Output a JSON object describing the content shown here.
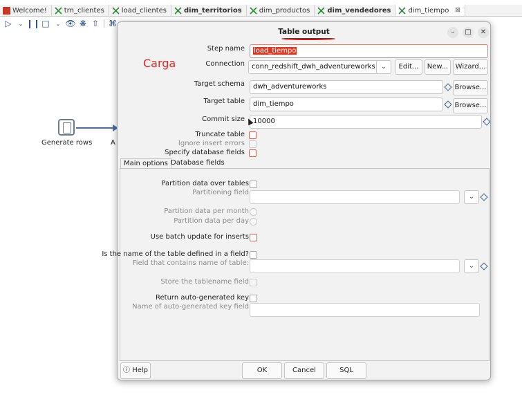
{
  "tabs": [
    {
      "label": "Welcome!",
      "bold": false,
      "icon": "kettle-icon"
    },
    {
      "label": "trn_clientes",
      "bold": false,
      "icon": "transformation-icon"
    },
    {
      "label": "load_clientes",
      "bold": false,
      "icon": "transformation-icon"
    },
    {
      "label": "dim_territorios",
      "bold": true,
      "icon": "transformation-icon"
    },
    {
      "label": "dim_productos",
      "bold": false,
      "icon": "transformation-icon"
    },
    {
      "label": "dim_vendedores",
      "bold": true,
      "icon": "transformation-icon"
    },
    {
      "label": "dim_tiempo",
      "bold": false,
      "icon": "transformation-icon",
      "close": "⊠"
    }
  ],
  "canvas": {
    "step1_label": "Generate rows",
    "step2_label_partial": "A"
  },
  "dialog": {
    "title": "Table output",
    "annotation": "Carga",
    "step_name_label": "Step name",
    "step_name_value": "load_tiempo",
    "connection_label": "Connection",
    "connection_value": "conn_redshift_dwh_adventureworks",
    "edit_button": "Edit...",
    "new_button": "New...",
    "wizard_button": "Wizard...",
    "target_schema_label": "Target schema",
    "target_schema_value": "dwh_adventureworks",
    "browse_button": "Browse...",
    "target_table_label": "Target table",
    "target_table_value": "dim_tiempo",
    "commit_size_label": "Commit size",
    "commit_size_value": "10000",
    "truncate_table_label": "Truncate table",
    "ignore_insert_errors_label": "Ignore insert errors",
    "specify_database_fields_label": "Specify database fields",
    "tab_main_options": "Main options",
    "tab_database_fields": "Database fields",
    "partition_data_label": "Partition data over tables",
    "partitioning_field_label": "Partitioning field",
    "partition_per_month_label": "Partition data per month",
    "partition_per_day_label": "Partition data per day",
    "use_batch_update_label": "Use batch update for inserts",
    "table_name_in_field_label": "Is the name of the table defined in a field?",
    "field_contains_table_label": "Field that contains name of table:",
    "store_tablename_label": "Store the tablename field",
    "return_autokey_label": "Return auto-generated key",
    "autokey_field_label": "Name of auto-generated key field",
    "help_button": "Help",
    "ok_button": "OK",
    "cancel_button": "Cancel",
    "sql_button": "SQL"
  }
}
